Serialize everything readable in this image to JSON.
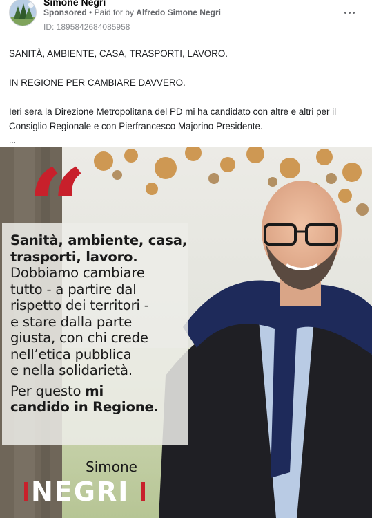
{
  "post": {
    "page_name": "Simone Negri",
    "sponsored_label": "Sponsored",
    "separator": "•",
    "paid_for_prefix": "Paid for by",
    "payer_name": "Alfredo Simone Negri",
    "ad_id": "ID: 1895842684085958",
    "more_icon": "more-horizontal-icon"
  },
  "body": {
    "line1": "SANITÀ, AMBIENTE, CASA, TRASPORTI, LAVORO.",
    "line2": "IN REGIONE PER CAMBIARE DAVVERO.",
    "line3": "Ieri sera la Direzione Metropolitana del PD mi ha candidato con altre e altri per il Consiglio Regionale e con Pierfrancesco Majorino Presidente.",
    "see_more": "..."
  },
  "ad_image": {
    "quote_mark": "“",
    "quote_bold_1": "Sanità, ambiente, casa,",
    "quote_bold_2": "trasporti, lavoro.",
    "quote_lines": [
      "Dobbiamo cambiare",
      "tutto - a partire dal",
      "rispetto dei territori -",
      "e stare dalla parte",
      "giusta, con chi crede",
      "nell’etica pubblica",
      "e nella solidarietà."
    ],
    "closing_prefix": "Per questo",
    "closing_bold_1": "mi",
    "closing_bold_2": "candido in Regione.",
    "first_name": "Simone",
    "last_name": "NEGRI",
    "accent_color": "#c8202b"
  }
}
